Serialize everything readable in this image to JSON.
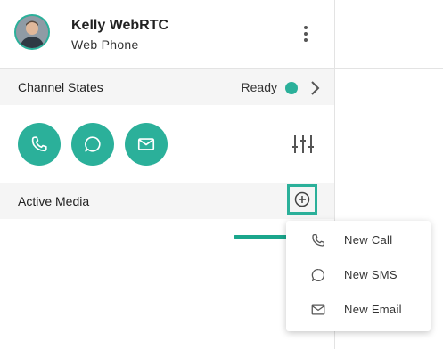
{
  "user": {
    "name": "Kelly WebRTC",
    "subtitle": "Web Phone"
  },
  "channel_states": {
    "label": "Channel States",
    "status": "Ready",
    "status_color": "#2bb09a"
  },
  "actions": [
    {
      "icon": "phone-icon"
    },
    {
      "icon": "chat-icon"
    },
    {
      "icon": "email-icon"
    }
  ],
  "active_media": {
    "label": "Active Media"
  },
  "menu": {
    "items": [
      {
        "label": "New Call",
        "icon": "phone-icon"
      },
      {
        "label": "New SMS",
        "icon": "chat-icon"
      },
      {
        "label": "New Email",
        "icon": "email-icon"
      }
    ]
  },
  "colors": {
    "accent": "#2bb09a",
    "row_bg": "#f5f5f5"
  }
}
